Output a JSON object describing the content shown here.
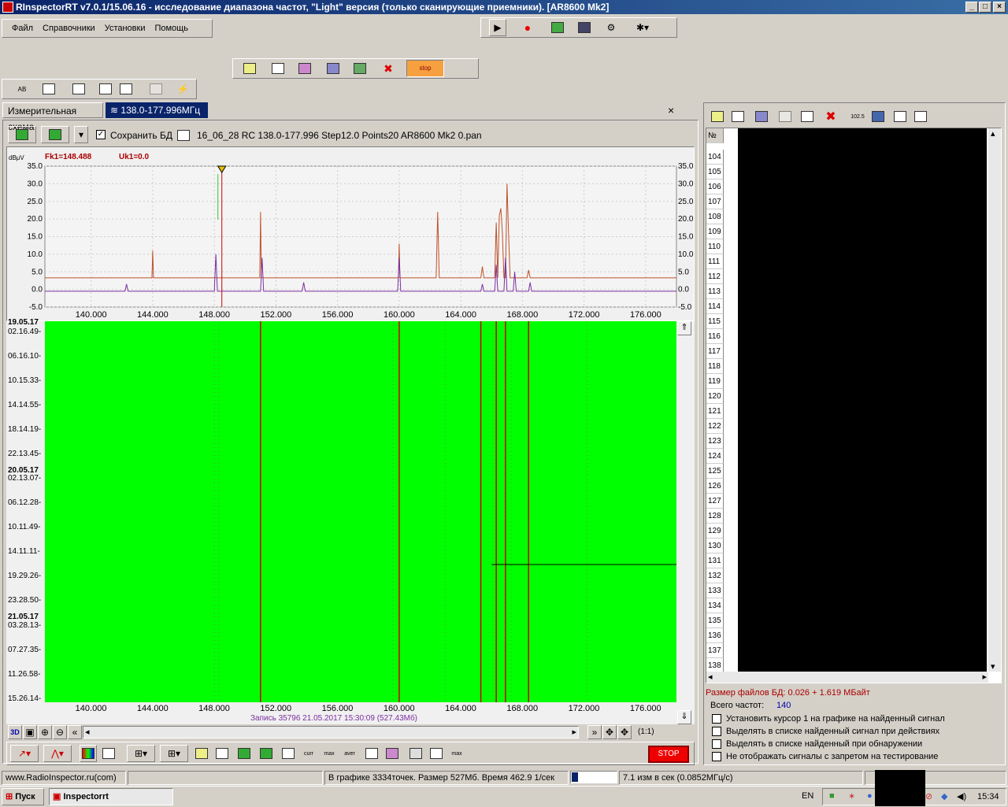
{
  "window": {
    "title": "RInspectorRT v7.0.1/15.06.16 - исследование диапазона частот, \"Light\" версия (только сканирующие приемники). [AR8600 Mk2]",
    "min": "_",
    "max": "□",
    "close": "×"
  },
  "menu": [
    "Файл",
    "Справочники",
    "Установки",
    "Помощь"
  ],
  "tabs": [
    {
      "label": "Измерительная схема"
    },
    {
      "label": "138.0-177.996МГц"
    }
  ],
  "tab_close": "×",
  "toolbar2": {
    "save_label": "Сохранить БД",
    "file_label": "16_06_28 RC 138.0-177.996 Step12.0 Points20 AR8600 Mk2 0.pan"
  },
  "spectrum": {
    "marker_freq": "Fk1=148.488",
    "marker_level": "Uk1=0.0",
    "unit": "dBμV",
    "y_ticks": [
      "35.0",
      "30.0",
      "25.0",
      "20.0",
      "15.0",
      "10.0",
      "5.0",
      "0.0",
      "-5.0"
    ],
    "x_ticks": [
      "140.000",
      "144.000",
      "148.000",
      "152.000",
      "156.000",
      "160.000",
      "164.000",
      "168.000",
      "172.000",
      "176.000"
    ]
  },
  "chart_data": {
    "type": "line",
    "ylabel": "dBμV",
    "xlim": [
      137.0,
      178.0
    ],
    "ylim": [
      -5.0,
      35.0
    ],
    "series": [
      {
        "x": [
          137.0,
          143.95,
          144.0,
          144.05,
          150.95,
          151.0,
          151.05,
          159.95,
          160.0,
          160.05,
          162.4,
          162.5,
          162.6,
          162.7,
          165.3,
          165.4,
          165.5,
          166.2,
          166.3,
          166.4,
          166.5,
          166.6,
          166.7,
          166.8,
          166.9,
          167.0,
          167.1,
          167.2,
          167.3,
          167.4,
          168.3,
          168.4,
          168.5,
          178.0
        ],
        "values": [
          3.3,
          3.3,
          11.0,
          3.3,
          3.3,
          22.0,
          3.3,
          3.3,
          13.0,
          3.3,
          3.3,
          22.0,
          3.3,
          3.3,
          3.3,
          6.5,
          3.3,
          3.3,
          19.0,
          3.3,
          21.0,
          23.0,
          16.0,
          3.3,
          3.3,
          30.0,
          16.0,
          3.3,
          3.3,
          3.3,
          3.3,
          5.5,
          3.3,
          3.3
        ]
      },
      {
        "x": [
          137.0,
          142.2,
          142.3,
          142.4,
          148.0,
          148.1,
          148.2,
          151.0,
          151.1,
          151.2,
          153.7,
          153.8,
          153.9,
          159.9,
          160.0,
          160.1,
          165.3,
          165.4,
          165.5,
          166.2,
          166.3,
          166.4,
          166.8,
          166.9,
          167.0,
          167.4,
          167.5,
          167.6,
          168.4,
          168.5,
          168.6,
          178.0
        ],
        "values": [
          -0.5,
          -0.5,
          1.5,
          -0.5,
          -0.5,
          10.0,
          -0.5,
          -0.5,
          9.0,
          -0.5,
          -0.5,
          2.0,
          -0.5,
          -0.5,
          9.0,
          -0.5,
          -0.5,
          1.5,
          -0.5,
          -0.5,
          7.0,
          -0.5,
          -0.5,
          9.0,
          -0.5,
          -0.5,
          5.0,
          -0.5,
          -0.5,
          2.0,
          -0.5,
          -0.5
        ]
      }
    ]
  },
  "waterfall": {
    "times": [
      "19.05.17",
      "02.16.49-",
      "06.16.10-",
      "10.15.33-",
      "14.14.55-",
      "18.14.19-",
      "22.13.45-",
      "20.05.17",
      "02.13.07-",
      "06.12.28-",
      "10.11.49-",
      "14.11.11-",
      "19.29.26-",
      "23.28.50-",
      "21.05.17",
      "03.28.13-",
      "07.27.35-",
      "11.26.58-",
      "15.26.14-"
    ],
    "record": "Запись 35796 21.05.2017 15:30:09 (527.43Мб)",
    "scale": "(1:1)"
  },
  "right": {
    "header_num": "№",
    "row_numbers": [
      "104",
      "105",
      "106",
      "107",
      "108",
      "109",
      "110",
      "111",
      "112",
      "113",
      "114",
      "115",
      "116",
      "117",
      "118",
      "119",
      "120",
      "121",
      "122",
      "123",
      "124",
      "125",
      "126",
      "127",
      "128",
      "129",
      "130",
      "131",
      "132",
      "133",
      "134",
      "135",
      "136",
      "137",
      "138"
    ],
    "db_size": "Размер файлов БД: 0.026 + 1.619 МБайт",
    "total_label": "Всего частот:",
    "total_value": "140",
    "options": [
      "Установить курсор 1 на графике на найденный сигнал",
      "Выделять в списке найденный сигнал при действиях",
      "Выделять в списке найденный при обнаружении",
      "Не отображать сигналы с запретом на тестирование"
    ]
  },
  "bottom_toolbar": {
    "stop": "STOP",
    "mode3d": "3D"
  },
  "statusbar": {
    "site": "www.RadioInspector.ru(com)",
    "points": "В графике 3334точек.  Размер 527Мб. Время 462.9 1/сек",
    "rate": "7.1 изм в сек (0.0852МГц/с)"
  },
  "taskbar": {
    "start": "Пуск",
    "app": "Inspectorrt",
    "lang": "EN",
    "clock": "15:34"
  },
  "colors": {
    "waterfall": "#00ff00",
    "trace1": "#c0502a",
    "trace2": "#7a2fa0",
    "marker": "#d00000"
  }
}
